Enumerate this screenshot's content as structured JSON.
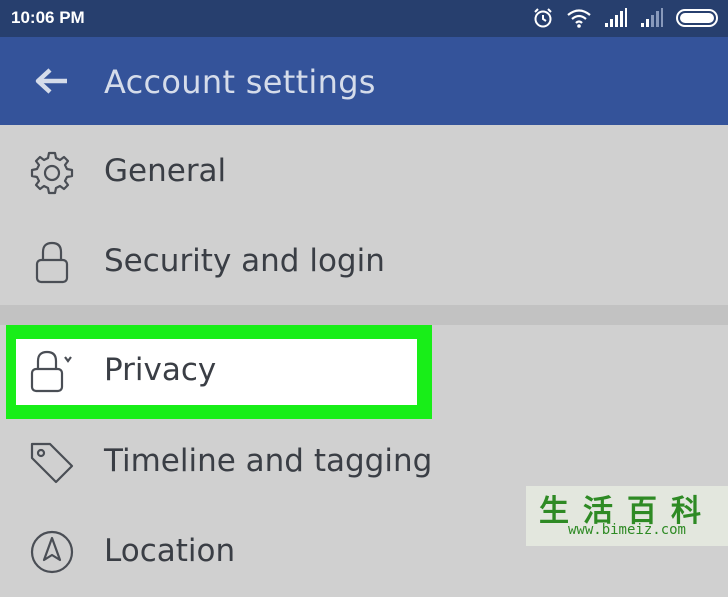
{
  "status_bar": {
    "time": "10:06 PM",
    "icons": [
      "alarm-icon",
      "wifi-icon",
      "signal-icon",
      "signal-weak-icon",
      "battery-icon"
    ]
  },
  "app_bar": {
    "title": "Account settings",
    "back_icon": "back-arrow-icon",
    "background": "#34539a"
  },
  "menu": {
    "items": [
      {
        "label": "General",
        "icon": "gear-icon"
      },
      {
        "label": "Security and login",
        "icon": "lock-icon"
      },
      {
        "label": "Privacy",
        "icon": "lock-chevron-icon",
        "highlighted": true
      },
      {
        "label": "Timeline and tagging",
        "icon": "tag-icon"
      },
      {
        "label": "Location",
        "icon": "location-icon"
      }
    ]
  },
  "highlight_color": "#18ee18",
  "watermark": {
    "title": "生活百科",
    "url": "www.bimeiz.com"
  }
}
